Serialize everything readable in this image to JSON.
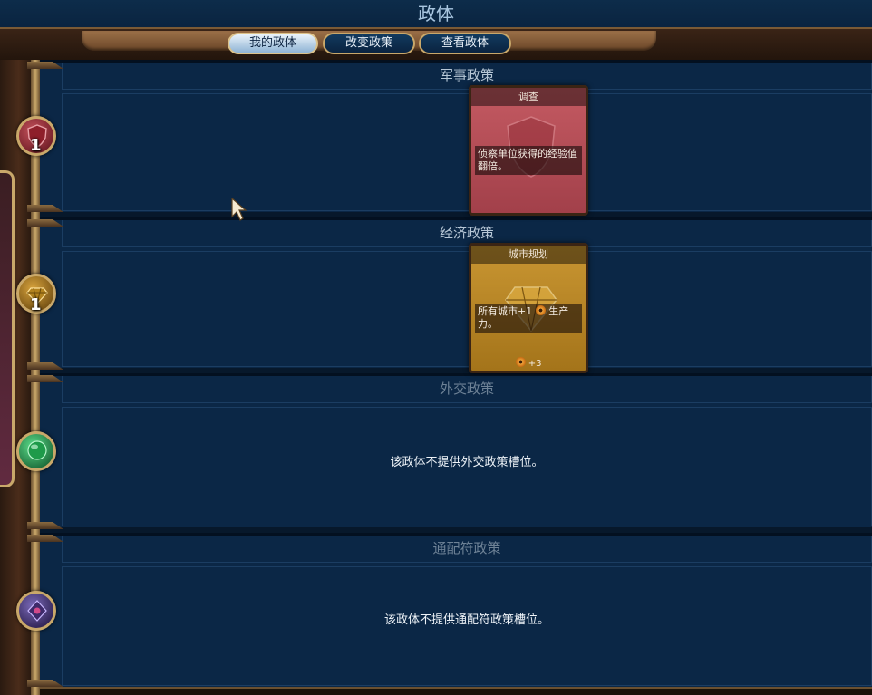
{
  "window": {
    "title": "政体"
  },
  "tabs": [
    {
      "label": "我的政体",
      "active": true
    },
    {
      "label": "改变政策",
      "active": false
    },
    {
      "label": "查看政体",
      "active": false
    }
  ],
  "sections": {
    "military": {
      "header": "军事政策",
      "slot_count": "1",
      "card": {
        "title": "调查",
        "description": "侦察单位获得的经验值翻倍。",
        "color": "#b24a52"
      }
    },
    "economic": {
      "header": "经济政策",
      "slot_count": "1",
      "card": {
        "title": "城市规划",
        "description_before_icon": "所有城市+1",
        "description_after_icon": "生产力。",
        "icon": "production-icon",
        "cost": "+3",
        "color": "#b2821e"
      }
    },
    "diplomatic": {
      "header": "外交政策",
      "message": "该政体不提供外交政策槽位。"
    },
    "wildcard": {
      "header": "通配符政策",
      "message": "该政体不提供通配符政策槽位。"
    }
  },
  "colors": {
    "panel": "#0b2746",
    "frame_gold": "#c9a86a",
    "military": "#8e1f2a",
    "economic": "#b2821e",
    "diplomatic": "#1e9a4a",
    "wildcard": "#3e2a6a"
  }
}
